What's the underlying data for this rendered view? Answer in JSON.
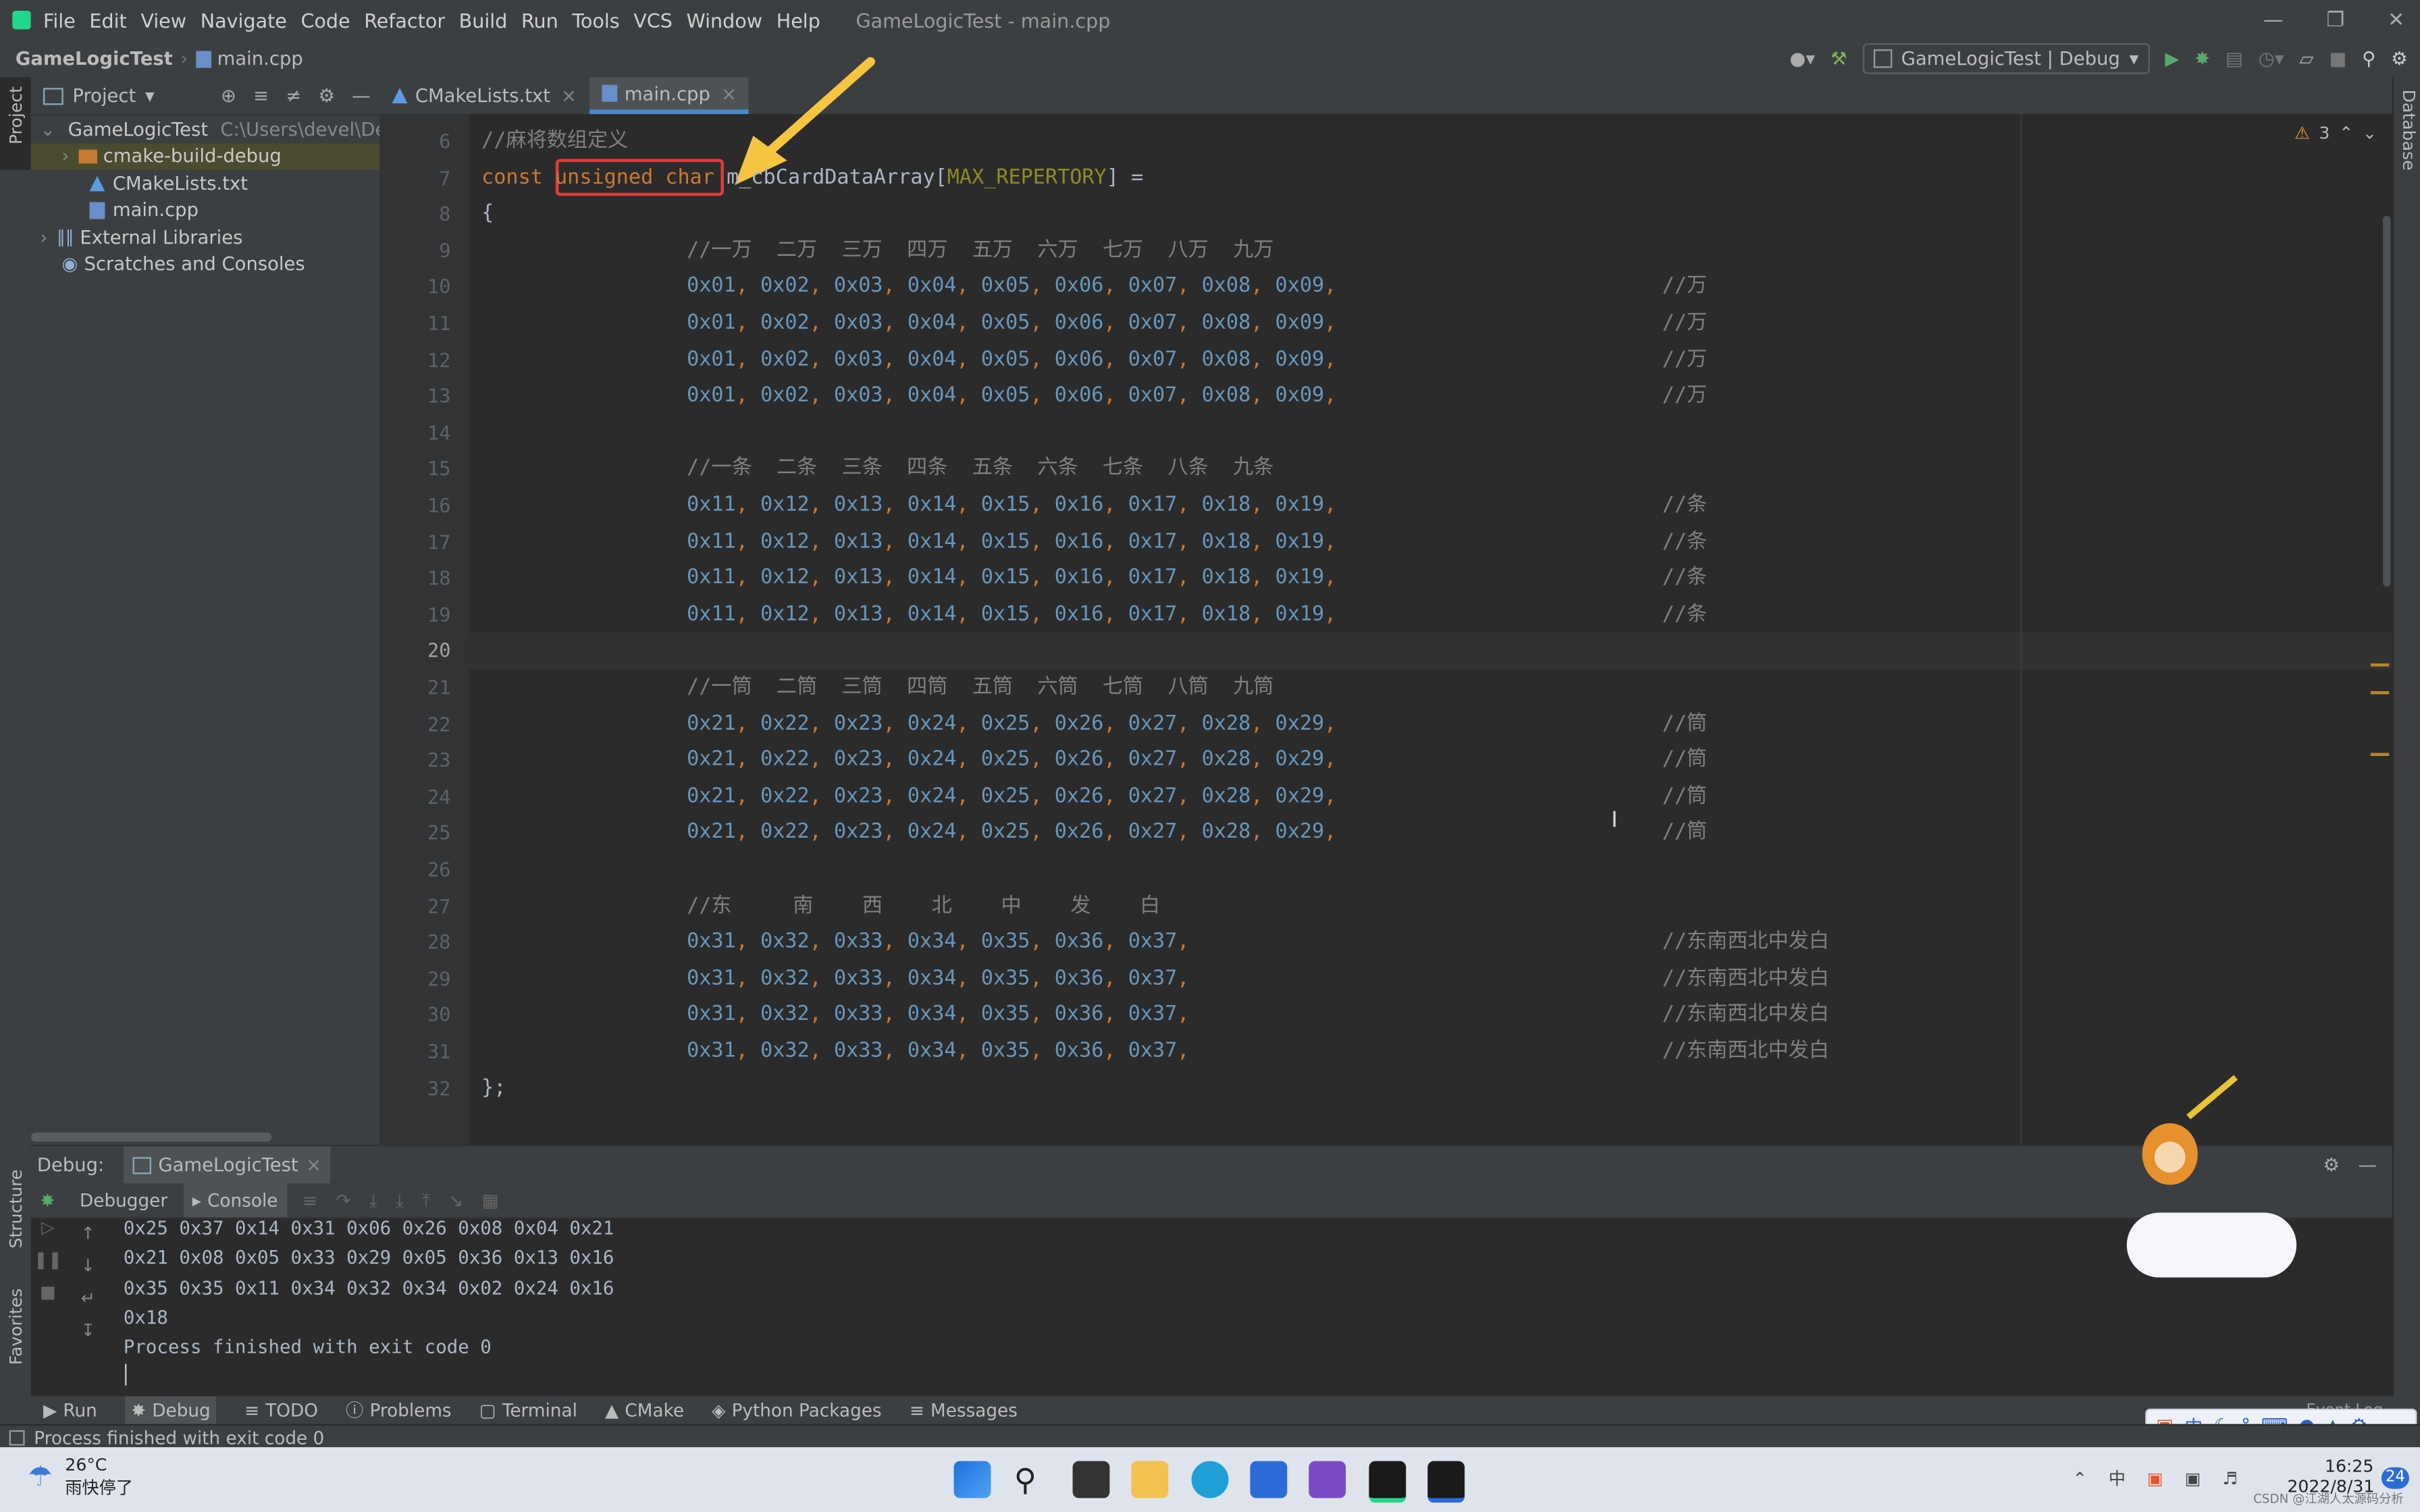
{
  "window": {
    "title": "GameLogicTest - main.cpp"
  },
  "menu": [
    "File",
    "Edit",
    "View",
    "Navigate",
    "Code",
    "Refactor",
    "Build",
    "Run",
    "Tools",
    "VCS",
    "Window",
    "Help"
  ],
  "breadcrumb": {
    "project": "GameLogicTest",
    "file": "main.cpp"
  },
  "run_config": "GameLogicTest | Debug",
  "project_panel": {
    "title": "Project",
    "items": [
      {
        "label": "GameLogicTest",
        "hint": "C:\\Users\\devel\\Deskt"
      },
      {
        "label": "cmake-build-debug"
      },
      {
        "label": "CMakeLists.txt"
      },
      {
        "label": "main.cpp"
      },
      {
        "label": "External Libraries"
      },
      {
        "label": "Scratches and Consoles"
      }
    ]
  },
  "side_labels": {
    "project": "Project",
    "structure": "Structure",
    "favorites": "Favorites",
    "database": "Database"
  },
  "tabs": [
    {
      "label": "CMakeLists.txt"
    },
    {
      "label": "main.cpp"
    }
  ],
  "inspections": "3",
  "editor": {
    "line_numbers": [
      "6",
      "7",
      "8",
      "9",
      "10",
      "11",
      "12",
      "13",
      "14",
      "15",
      "16",
      "17",
      "18",
      "19",
      "20",
      "21",
      "22",
      "23",
      "24",
      "25",
      "26",
      "27",
      "28",
      "29",
      "30",
      "31",
      "32"
    ],
    "comment_l6": "//麻将数组定义",
    "l7_const": "const ",
    "l7_type": "unsigned char",
    "l7_ident": " m_cbCardDataArray[",
    "l7_macro": "MAX_REPERTORY",
    "l7_tail": "] =",
    "l8": "{",
    "header_wan": "//一万  二万  三万  四万  五万  六万  七万  八万  九万",
    "row_wan": "0x01, 0x02, 0x03, 0x04, 0x05, 0x06, 0x07, 0x08, 0x09,",
    "cm_wan": "//万",
    "header_tiao": "//一条  二条  三条  四条  五条  六条  七条  八条  九条",
    "row_tiao": "0x11, 0x12, 0x13, 0x14, 0x15, 0x16, 0x17, 0x18, 0x19,",
    "cm_tiao": "//条",
    "header_tong": "//一筒  二筒  三筒  四筒  五筒  六筒  七筒  八筒  九筒",
    "row_tong": "0x21, 0x22, 0x23, 0x24, 0x25, 0x26, 0x27, 0x28, 0x29,",
    "cm_tong": "//筒",
    "header_zi": "//东     南    西    北    中    发    白",
    "row_zi": "0x31, 0x32, 0x33, 0x34, 0x35, 0x36, 0x37,",
    "cm_zi": "//东南西北中发白",
    "l32": "};"
  },
  "debug": {
    "label": "Debug:",
    "session": "GameLogicTest",
    "tab_debugger": "Debugger",
    "tab_console": "Console",
    "console_lines": [
      "0x25 0x37 0x14 0x31 0x06 0x26 0x08 0x04 0x21",
      "0x21 0x08 0x05 0x33 0x29 0x05 0x36 0x13 0x16",
      "0x35 0x35 0x11 0x34 0x32 0x34 0x02 0x24 0x16",
      "0x18",
      "Process finished with exit code 0"
    ]
  },
  "toolwindows": [
    "Run",
    "Debug",
    "TODO",
    "Problems",
    "Terminal",
    "CMake",
    "Python Packages",
    "Messages"
  ],
  "event_log": "Event Log",
  "status": "Process finished with exit code 0",
  "taskbar": {
    "weather_temp": "26°C",
    "weather_desc": "雨快停了",
    "time": "16:25",
    "date": "2022/8/31",
    "notifications": "24",
    "ime": "中",
    "watermark": "CSDN @江湖人太源码分析"
  },
  "colors": {
    "accent": "#4a88c7",
    "highlight_box": "#e03c3c",
    "arrow": "#f5c542"
  }
}
